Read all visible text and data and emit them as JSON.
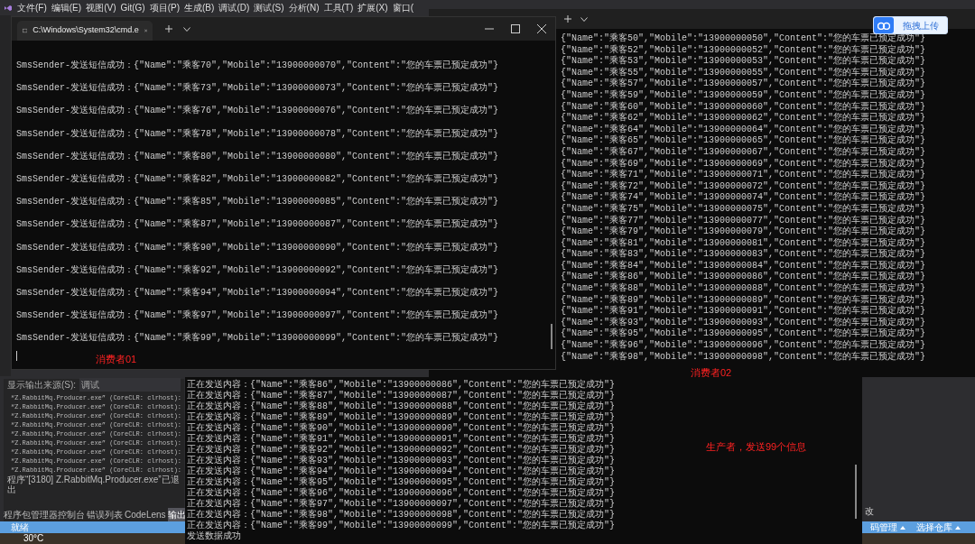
{
  "menu_bar": {
    "items": [
      "文件(F)",
      "编辑(E)",
      "视图(V)",
      "Git(G)",
      "项目(P)",
      "生成(B)",
      "调试(D)",
      "测试(S)",
      "分析(N)",
      "工具(T)",
      "扩展(X)",
      "窗口("
    ]
  },
  "upload_button": {
    "label": "拖拽上传"
  },
  "consumer_01": {
    "tab_title": "C:\\Windows\\System32\\cmd.e",
    "lines": [
      "SmsSender-发送短信成功：{\"Name\":\"乘客70\",\"Mobile\":\"13900000070\",\"Content\":\"您的车票已预定成功\"}",
      "SmsSender-发送短信成功：{\"Name\":\"乘客73\",\"Mobile\":\"13900000073\",\"Content\":\"您的车票已预定成功\"}",
      "SmsSender-发送短信成功：{\"Name\":\"乘客76\",\"Mobile\":\"13900000076\",\"Content\":\"您的车票已预定成功\"}",
      "SmsSender-发送短信成功：{\"Name\":\"乘客78\",\"Mobile\":\"13900000078\",\"Content\":\"您的车票已预定成功\"}",
      "SmsSender-发送短信成功：{\"Name\":\"乘客80\",\"Mobile\":\"13900000080\",\"Content\":\"您的车票已预定成功\"}",
      "SmsSender-发送短信成功：{\"Name\":\"乘客82\",\"Mobile\":\"13900000082\",\"Content\":\"您的车票已预定成功\"}",
      "SmsSender-发送短信成功：{\"Name\":\"乘客85\",\"Mobile\":\"13900000085\",\"Content\":\"您的车票已预定成功\"}",
      "SmsSender-发送短信成功：{\"Name\":\"乘客87\",\"Mobile\":\"13900000087\",\"Content\":\"您的车票已预定成功\"}",
      "SmsSender-发送短信成功：{\"Name\":\"乘客90\",\"Mobile\":\"13900000090\",\"Content\":\"您的车票已预定成功\"}",
      "SmsSender-发送短信成功：{\"Name\":\"乘客92\",\"Mobile\":\"13900000092\",\"Content\":\"您的车票已预定成功\"}",
      "SmsSender-发送短信成功：{\"Name\":\"乘客94\",\"Mobile\":\"13900000094\",\"Content\":\"您的车票已预定成功\"}",
      "SmsSender-发送短信成功：{\"Name\":\"乘客97\",\"Mobile\":\"13900000097\",\"Content\":\"您的车票已预定成功\"}",
      "SmsSender-发送短信成功：{\"Name\":\"乘客99\",\"Mobile\":\"13900000099\",\"Content\":\"您的车票已预定成功\"}"
    ],
    "annotation": "消费者01"
  },
  "consumer_02": {
    "lines": [
      "{\"Name\":\"乘客50\",\"Mobile\":\"13900000050\",\"Content\":\"您的车票已预定成功\"}",
      "{\"Name\":\"乘客52\",\"Mobile\":\"13900000052\",\"Content\":\"您的车票已预定成功\"}",
      "{\"Name\":\"乘客53\",\"Mobile\":\"13900000053\",\"Content\":\"您的车票已预定成功\"}",
      "{\"Name\":\"乘客55\",\"Mobile\":\"13900000055\",\"Content\":\"您的车票已预定成功\"}",
      "{\"Name\":\"乘客57\",\"Mobile\":\"13900000057\",\"Content\":\"您的车票已预定成功\"}",
      "{\"Name\":\"乘客59\",\"Mobile\":\"13900000059\",\"Content\":\"您的车票已预定成功\"}",
      "{\"Name\":\"乘客60\",\"Mobile\":\"13900000060\",\"Content\":\"您的车票已预定成功\"}",
      "{\"Name\":\"乘客62\",\"Mobile\":\"13900000062\",\"Content\":\"您的车票已预定成功\"}",
      "{\"Name\":\"乘客64\",\"Mobile\":\"13900000064\",\"Content\":\"您的车票已预定成功\"}",
      "{\"Name\":\"乘客65\",\"Mobile\":\"13900000065\",\"Content\":\"您的车票已预定成功\"}",
      "{\"Name\":\"乘客67\",\"Mobile\":\"13900000067\",\"Content\":\"您的车票已预定成功\"}",
      "{\"Name\":\"乘客69\",\"Mobile\":\"13900000069\",\"Content\":\"您的车票已预定成功\"}",
      "{\"Name\":\"乘客71\",\"Mobile\":\"13900000071\",\"Content\":\"您的车票已预定成功\"}",
      "{\"Name\":\"乘客72\",\"Mobile\":\"13900000072\",\"Content\":\"您的车票已预定成功\"}",
      "{\"Name\":\"乘客74\",\"Mobile\":\"13900000074\",\"Content\":\"您的车票已预定成功\"}",
      "{\"Name\":\"乘客75\",\"Mobile\":\"13900000075\",\"Content\":\"您的车票已预定成功\"}",
      "{\"Name\":\"乘客77\",\"Mobile\":\"13900000077\",\"Content\":\"您的车票已预定成功\"}",
      "{\"Name\":\"乘客79\",\"Mobile\":\"13900000079\",\"Content\":\"您的车票已预定成功\"}",
      "{\"Name\":\"乘客81\",\"Mobile\":\"13900000081\",\"Content\":\"您的车票已预定成功\"}",
      "{\"Name\":\"乘客83\",\"Mobile\":\"13900000083\",\"Content\":\"您的车票已预定成功\"}",
      "{\"Name\":\"乘客84\",\"Mobile\":\"13900000084\",\"Content\":\"您的车票已预定成功\"}",
      "{\"Name\":\"乘客86\",\"Mobile\":\"13900000086\",\"Content\":\"您的车票已预定成功\"}",
      "{\"Name\":\"乘客88\",\"Mobile\":\"13900000088\",\"Content\":\"您的车票已预定成功\"}",
      "{\"Name\":\"乘客89\",\"Mobile\":\"13900000089\",\"Content\":\"您的车票已预定成功\"}",
      "{\"Name\":\"乘客91\",\"Mobile\":\"13900000091\",\"Content\":\"您的车票已预定成功\"}",
      "{\"Name\":\"乘客93\",\"Mobile\":\"13900000093\",\"Content\":\"您的车票已预定成功\"}",
      "{\"Name\":\"乘客95\",\"Mobile\":\"13900000095\",\"Content\":\"您的车票已预定成功\"}",
      "{\"Name\":\"乘客96\",\"Mobile\":\"13900000096\",\"Content\":\"您的车票已预定成功\"}",
      "{\"Name\":\"乘客98\",\"Mobile\":\"13900000098\",\"Content\":\"您的车票已预定成功\"}"
    ],
    "annotation": "消费者02"
  },
  "producer": {
    "lines": [
      "正在发送内容：{\"Name\":\"乘客86\",\"Mobile\":\"13900000086\",\"Content\":\"您的车票已预定成功\"}",
      "正在发送内容：{\"Name\":\"乘客87\",\"Mobile\":\"13900000087\",\"Content\":\"您的车票已预定成功\"}",
      "正在发送内容：{\"Name\":\"乘客88\",\"Mobile\":\"13900000088\",\"Content\":\"您的车票已预定成功\"}",
      "正在发送内容：{\"Name\":\"乘客89\",\"Mobile\":\"13900000089\",\"Content\":\"您的车票已预定成功\"}",
      "正在发送内容：{\"Name\":\"乘客90\",\"Mobile\":\"13900000090\",\"Content\":\"您的车票已预定成功\"}",
      "正在发送内容：{\"Name\":\"乘客91\",\"Mobile\":\"13900000091\",\"Content\":\"您的车票已预定成功\"}",
      "正在发送内容：{\"Name\":\"乘客92\",\"Mobile\":\"13900000092\",\"Content\":\"您的车票已预定成功\"}",
      "正在发送内容：{\"Name\":\"乘客93\",\"Mobile\":\"13900000093\",\"Content\":\"您的车票已预定成功\"}",
      "正在发送内容：{\"Name\":\"乘客94\",\"Mobile\":\"13900000094\",\"Content\":\"您的车票已预定成功\"}",
      "正在发送内容：{\"Name\":\"乘客95\",\"Mobile\":\"13900000095\",\"Content\":\"您的车票已预定成功\"}",
      "正在发送内容：{\"Name\":\"乘客96\",\"Mobile\":\"13900000096\",\"Content\":\"您的车票已预定成功\"}",
      "正在发送内容：{\"Name\":\"乘客97\",\"Mobile\":\"13900000097\",\"Content\":\"您的车票已预定成功\"}",
      "正在发送内容：{\"Name\":\"乘客98\",\"Mobile\":\"13900000098\",\"Content\":\"您的车票已预定成功\"}",
      "正在发送内容：{\"Name\":\"乘客99\",\"Mobile\":\"13900000099\",\"Content\":\"您的车票已预定成功\"}",
      "发送数据成功"
    ],
    "annotation": "生产者，发送99个信息"
  },
  "output_pane": {
    "source_label": "显示输出来源(S):",
    "source_value": "调试",
    "lines": [
      "“Z.RabbitMq.Producer.exe” (CoreCLR: clrhost):",
      "“Z.RabbitMq.Producer.exe” (CoreCLR: clrhost):",
      "“Z.RabbitMq.Producer.exe” (CoreCLR: clrhost):",
      "“Z.RabbitMq.Producer.exe” (CoreCLR: clrhost):",
      "“Z.RabbitMq.Producer.exe” (CoreCLR: clrhost):",
      "“Z.RabbitMq.Producer.exe” (CoreCLR: clrhost):",
      "“Z.RabbitMq.Producer.exe” (CoreCLR: clrhost):",
      "“Z.RabbitMq.Producer.exe” (CoreCLR: clrhost):",
      "“Z.RabbitMq.Producer.exe” (CoreCLR: clrhost):"
    ],
    "exit_line": "程序“[3180] Z.RabbitMq.Producer.exe”已退出",
    "tabs": [
      {
        "label": "程序包管理器控制台",
        "selected": false
      },
      {
        "label": "错误列表",
        "selected": false
      },
      {
        "label": "CodeLens",
        "selected": false
      },
      {
        "label": "输出",
        "selected": true
      }
    ]
  },
  "side_label": "改",
  "status_bar": {
    "text": "就绪",
    "right_items": [
      "码管理",
      "选择仓库"
    ]
  },
  "taskbar": {
    "weather": "30°C"
  }
}
